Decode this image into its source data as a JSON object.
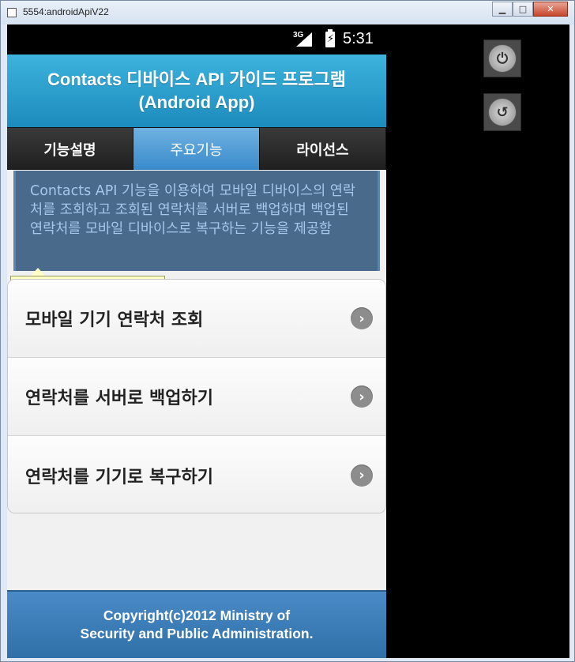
{
  "window": {
    "title": "5554:androidApiV22",
    "minimize": "▁",
    "maximize": "□",
    "close": "✕"
  },
  "statusbar": {
    "network": "3G",
    "time": "5:31"
  },
  "header": {
    "title_line1": "Contacts 디바이스 API 가이드 프로그램",
    "title_line2": "(Android App)"
  },
  "tabs": [
    {
      "label": "기능설명",
      "active": false
    },
    {
      "label": "주요기능",
      "active": true
    },
    {
      "label": "라이선스",
      "active": false
    }
  ],
  "content": {
    "description": "Contacts API 기능을 이용하여 모바일 디바이스의 연락처를 조회하고 조회된 연락처를 서버로 백업하며 백업된 연락처를 모바일 디바이스로 복구하는 기능을 제공함"
  },
  "inspector": {
    "tag": "div",
    "id": "#content",
    "width": "320",
    "height": "84",
    "unit": "px",
    "times": "×"
  },
  "menu": [
    {
      "label": "모바일 기기 연락처 조회",
      "icon": "chevron-right-circle-icon"
    },
    {
      "label": "연락처를 서버로 백업하기",
      "icon": "chevron-right-circle-icon"
    },
    {
      "label": "연락처를 기기로 복구하기",
      "icon": "chevron-right-circle-icon"
    }
  ],
  "footer": {
    "line1": "Copyright(c)2012 Ministry of",
    "line2": "Security and Public Administration."
  },
  "controls": {
    "power_glyph": "⏻",
    "back_glyph": "↺"
  },
  "colors": {
    "header": "#2aa3d2",
    "active_tab": "#4f9dd6",
    "content_bg": "#4a6a8c",
    "footer": "#3f80bd"
  }
}
